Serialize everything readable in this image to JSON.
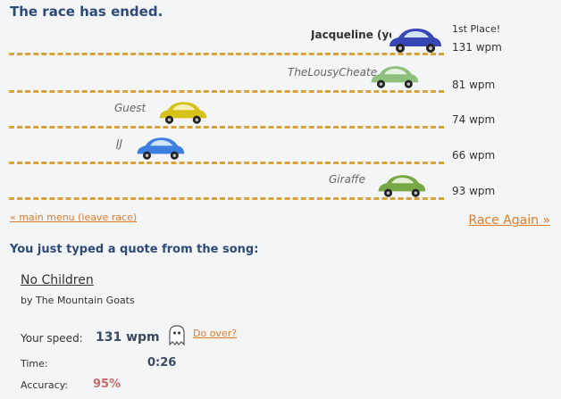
{
  "status": {
    "title": "The race has ended."
  },
  "racers": [
    {
      "name": "Jacqueline (you)",
      "wpm": "131 wpm",
      "place": "1st Place!",
      "color": "#3845b5"
    },
    {
      "name": "TheLousyCheater",
      "wpm": "81 wpm",
      "color": "#8fbf7d"
    },
    {
      "name": "Guest",
      "wpm": "74 wpm",
      "color": "#d6c21a"
    },
    {
      "name": "JJ",
      "wpm": "66 wpm",
      "color": "#3c7fe0"
    },
    {
      "name": "Giraffe",
      "wpm": "93 wpm",
      "color": "#78a845"
    }
  ],
  "nav": {
    "main_menu": "« main menu (leave race)",
    "race_again": "Race Again »"
  },
  "quote": {
    "heading": "You just typed a quote from the song:",
    "song": "No Children",
    "artist": "by The Mountain Goats"
  },
  "stats": {
    "speed_label": "Your speed:",
    "speed_value": "131 wpm",
    "do_over": "Do over?",
    "time_label": "Time:",
    "time_value": "0:26",
    "accuracy_label": "Accuracy:",
    "accuracy_value": "95%"
  },
  "colors": {
    "heading": "#2e4a78",
    "link": "#e07c2a",
    "lane_dash": "#d8a43a",
    "accuracy": "#c96a6a"
  }
}
